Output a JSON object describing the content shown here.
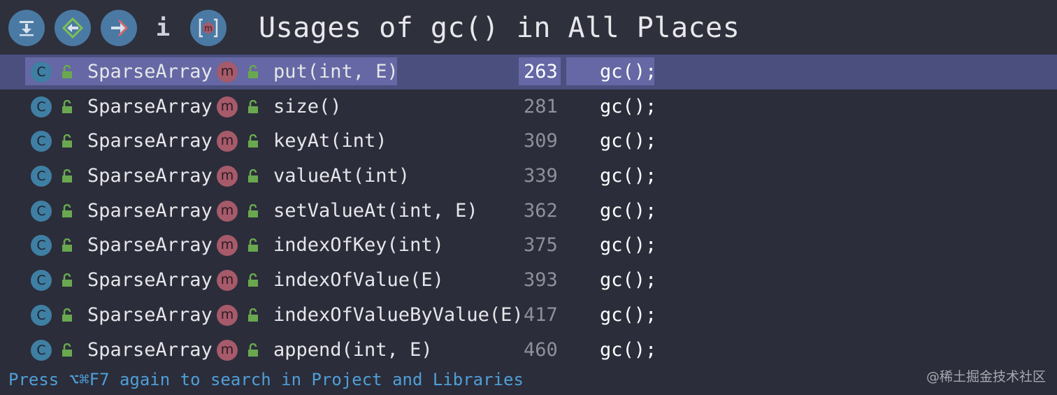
{
  "toolbar": {
    "title": "Usages of gc() in All Places",
    "info_label": "i",
    "buttons": [
      {
        "name": "export-icon"
      },
      {
        "name": "merge-icon"
      },
      {
        "name": "navigate-icon"
      },
      {
        "name": "method-filter-icon",
        "label": "m"
      }
    ],
    "accent": "#4a7aa3"
  },
  "usages": [
    {
      "class_icon": "C",
      "class": "SparseArray",
      "method_icon": "m",
      "method": "put(int, E)",
      "line": "263",
      "code": "gc();",
      "selected": true
    },
    {
      "class_icon": "C",
      "class": "SparseArray",
      "method_icon": "m",
      "method": "size()",
      "line": "281",
      "code": "gc();"
    },
    {
      "class_icon": "C",
      "class": "SparseArray",
      "method_icon": "m",
      "method": "keyAt(int)",
      "line": "309",
      "code": "gc();"
    },
    {
      "class_icon": "C",
      "class": "SparseArray",
      "method_icon": "m",
      "method": "valueAt(int)",
      "line": "339",
      "code": "gc();"
    },
    {
      "class_icon": "C",
      "class": "SparseArray",
      "method_icon": "m",
      "method": "setValueAt(int, E)",
      "line": "362",
      "code": "gc();"
    },
    {
      "class_icon": "C",
      "class": "SparseArray",
      "method_icon": "m",
      "method": "indexOfKey(int)",
      "line": "375",
      "code": "gc();"
    },
    {
      "class_icon": "C",
      "class": "SparseArray",
      "method_icon": "m",
      "method": "indexOfValue(E)",
      "line": "393",
      "code": "gc();"
    },
    {
      "class_icon": "C",
      "class": "SparseArray",
      "method_icon": "m",
      "method": "indexOfValueByValue(E)",
      "line": "417",
      "code": "gc();"
    },
    {
      "class_icon": "C",
      "class": "SparseArray",
      "method_icon": "m",
      "method": "append(int, E)",
      "line": "460",
      "code": "gc();"
    }
  ],
  "footer": {
    "hint": "Press ⌥⌘F7 again to search in Project and Libraries"
  },
  "watermark": "@稀土掘金技术社区",
  "colors": {
    "background": "#2b2d3a",
    "selected_row": "#4a4f7e",
    "selected_highlight": "#6568a4",
    "class_icon": "#3f7fa3",
    "method_icon": "#a65a6a",
    "lock": "#6aa84f",
    "hint": "#4f9fd8"
  }
}
